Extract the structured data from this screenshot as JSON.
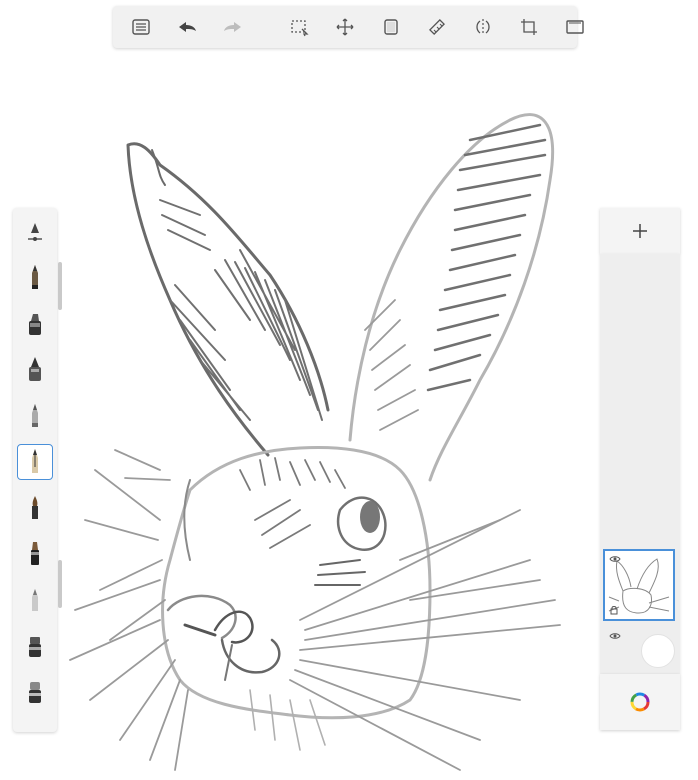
{
  "toolbar": {
    "tools": [
      "list-icon",
      "undo-icon",
      "redo-icon",
      "selection-icon",
      "transform-icon",
      "layer-copy-icon",
      "ruler-icon",
      "symmetry-icon",
      "crop-icon",
      "fullscreen-icon"
    ]
  },
  "brush_palette": {
    "items": [
      "brush-settings-icon",
      "pencil-icon",
      "marker-icon",
      "inkpen-icon",
      "airbrush-icon",
      "ballpoint-pen-icon",
      "paintbrush-icon",
      "flat-brush-icon",
      "eraser-pencil-icon",
      "smudge-icon",
      "soft-eraser-icon"
    ],
    "selected_index": 5
  },
  "layers": {
    "add_icon": "plus-icon",
    "items": [
      {
        "name": "sketch-layer",
        "selected": true,
        "visible_icon": "eye-icon",
        "lock_icon": "lock-icon"
      },
      {
        "name": "background-layer",
        "selected": false,
        "visible_icon": "eye-icon"
      }
    ],
    "color_icon": "color-wheel-icon"
  },
  "colors": {
    "accent": "#4a90d9",
    "panel": "#f4f4f4",
    "ink": "#555555",
    "ink_light": "#aaaaaa"
  }
}
